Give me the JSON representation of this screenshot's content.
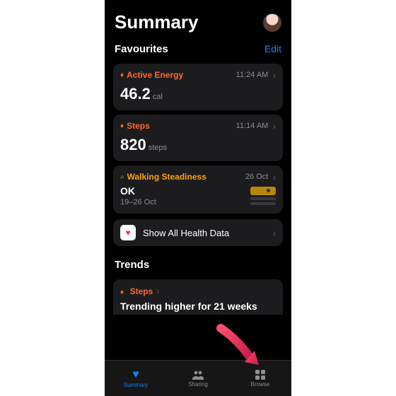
{
  "header": {
    "title": "Summary"
  },
  "favourites": {
    "title": "Favourites",
    "edit_label": "Edit",
    "items": [
      {
        "icon": "flame",
        "title": "Active Energy",
        "time": "11:24 AM",
        "value": "46.2",
        "unit": "cal"
      },
      {
        "icon": "flame",
        "title": "Steps",
        "time": "11:14 AM",
        "value": "820",
        "unit": "steps"
      },
      {
        "icon": "gauge",
        "title": "Walking Steadiness",
        "time": "26 Oct",
        "status": "OK",
        "range": "19–26 Oct"
      }
    ],
    "show_all_label": "Show All Health Data"
  },
  "trends": {
    "title": "Trends",
    "items": [
      {
        "icon": "flame",
        "title": "Steps",
        "summary": "Trending higher for 21 weeks"
      }
    ]
  },
  "tabs": [
    {
      "label": "Summary",
      "icon": "heart",
      "active": true
    },
    {
      "label": "Sharing",
      "icon": "people",
      "active": false
    },
    {
      "label": "Browse",
      "icon": "grid",
      "active": false
    }
  ]
}
